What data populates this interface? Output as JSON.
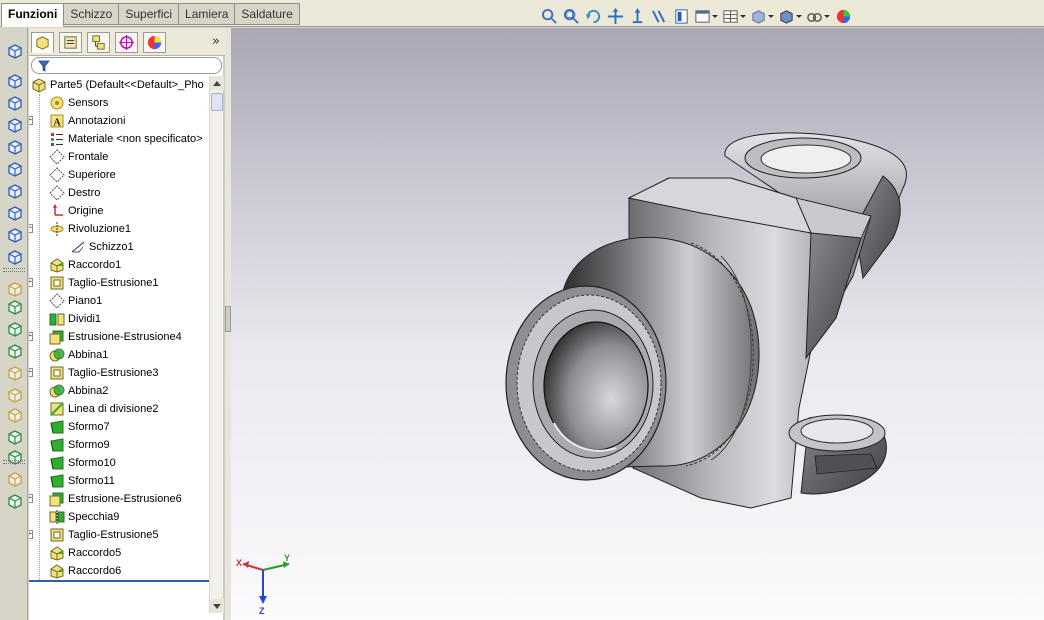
{
  "tabs": [
    {
      "label": "Funzioni",
      "active": true
    },
    {
      "label": "Schizzo",
      "active": false
    },
    {
      "label": "Superfici",
      "active": false
    },
    {
      "label": "Lamiera",
      "active": false
    },
    {
      "label": "Saldature",
      "active": false
    }
  ],
  "view_toolbar_icons": [
    "zoom-to-fit-icon",
    "zoom-to-area-icon",
    "rotate-view-icon",
    "pan-icon",
    "3d-drawing-view-icon",
    "section-view-icon",
    "dynamic-annotation-view-icon",
    "view-orientation-icon",
    "display-style-icon",
    "hide-show-items-icon",
    "edit-appearance-icon",
    "apply-scene-icon",
    "view-settings-icon"
  ],
  "command_strip_icons": [
    "smart-dimension-icon",
    "extruded-boss-icon",
    "revolved-boss-icon",
    "swept-boss-icon",
    "lofted-boss-icon",
    "boundary-boss-icon",
    "extruded-cut-icon",
    "hole-wizard-icon",
    "revolved-cut-icon",
    "curves-icon",
    "reference-plane-icon",
    "reference-axis-icon",
    "coordinate-system-icon",
    "point-icon",
    "mate-reference-icon",
    "fillet-icon",
    "shell-icon",
    "draft-icon",
    "helix-icon",
    "rib-icon",
    "wrap-icon"
  ],
  "feature_manager": {
    "panel_tabs": [
      "feature-manager-tab",
      "property-manager-tab",
      "configuration-manager-tab",
      "dimxpert-tab",
      "display-manager-tab"
    ],
    "more_glyph": "»",
    "root_label": "Parte5  (Default<<Default>_Pho",
    "items": [
      {
        "label": "Sensors",
        "icon": "sensor-icon",
        "expander": ""
      },
      {
        "label": "Annotazioni",
        "icon": "annotation-icon",
        "expander": "+"
      },
      {
        "label": "Materiale <non specificato>",
        "icon": "material-icon",
        "expander": ""
      },
      {
        "label": "Frontale",
        "icon": "plane-icon",
        "expander": ""
      },
      {
        "label": "Superiore",
        "icon": "plane-icon",
        "expander": ""
      },
      {
        "label": "Destro",
        "icon": "plane-icon",
        "expander": ""
      },
      {
        "label": "Origine",
        "icon": "origin-icon",
        "expander": ""
      },
      {
        "label": "Rivoluzione1",
        "icon": "revolve-icon",
        "expander": "−"
      },
      {
        "label": "Schizzo1",
        "icon": "sketch-icon",
        "expander": "",
        "child": true
      },
      {
        "label": "Raccordo1",
        "icon": "fillet-icon",
        "expander": ""
      },
      {
        "label": "Taglio-Estrusione1",
        "icon": "cut-extrude-icon",
        "expander": "+"
      },
      {
        "label": "Piano1",
        "icon": "plane-icon",
        "expander": ""
      },
      {
        "label": "Dividi1",
        "icon": "split-icon",
        "expander": ""
      },
      {
        "label": "Estrusione-Estrusione4",
        "icon": "boss-extrude-icon",
        "expander": "+"
      },
      {
        "label": "Abbina1",
        "icon": "combine-icon",
        "expander": ""
      },
      {
        "label": "Taglio-Estrusione3",
        "icon": "cut-extrude-icon",
        "expander": "+"
      },
      {
        "label": "Abbina2",
        "icon": "combine-icon",
        "expander": ""
      },
      {
        "label": "Linea di divisione2",
        "icon": "split-line-icon",
        "expander": ""
      },
      {
        "label": "Sformo7",
        "icon": "draft-icon",
        "expander": ""
      },
      {
        "label": "Sformo9",
        "icon": "draft-icon",
        "expander": ""
      },
      {
        "label": "Sformo10",
        "icon": "draft-icon",
        "expander": ""
      },
      {
        "label": "Sformo11",
        "icon": "draft-icon",
        "expander": ""
      },
      {
        "label": "Estrusione-Estrusione6",
        "icon": "boss-extrude-icon",
        "expander": "+"
      },
      {
        "label": "Specchia9",
        "icon": "mirror-icon",
        "expander": ""
      },
      {
        "label": "Taglio-Estrusione5",
        "icon": "cut-extrude-icon",
        "expander": "+"
      },
      {
        "label": "Raccordo5",
        "icon": "fillet-icon",
        "expander": ""
      },
      {
        "label": "Raccordo6",
        "icon": "fillet-icon",
        "expander": ""
      }
    ]
  },
  "triad": {
    "x": "X",
    "y": "Y",
    "z": "Z"
  },
  "colors": {
    "accent": "#2f5fa8",
    "tree_icon_yellow": "#f3e27a",
    "tree_icon_green": "#2fae2f"
  }
}
